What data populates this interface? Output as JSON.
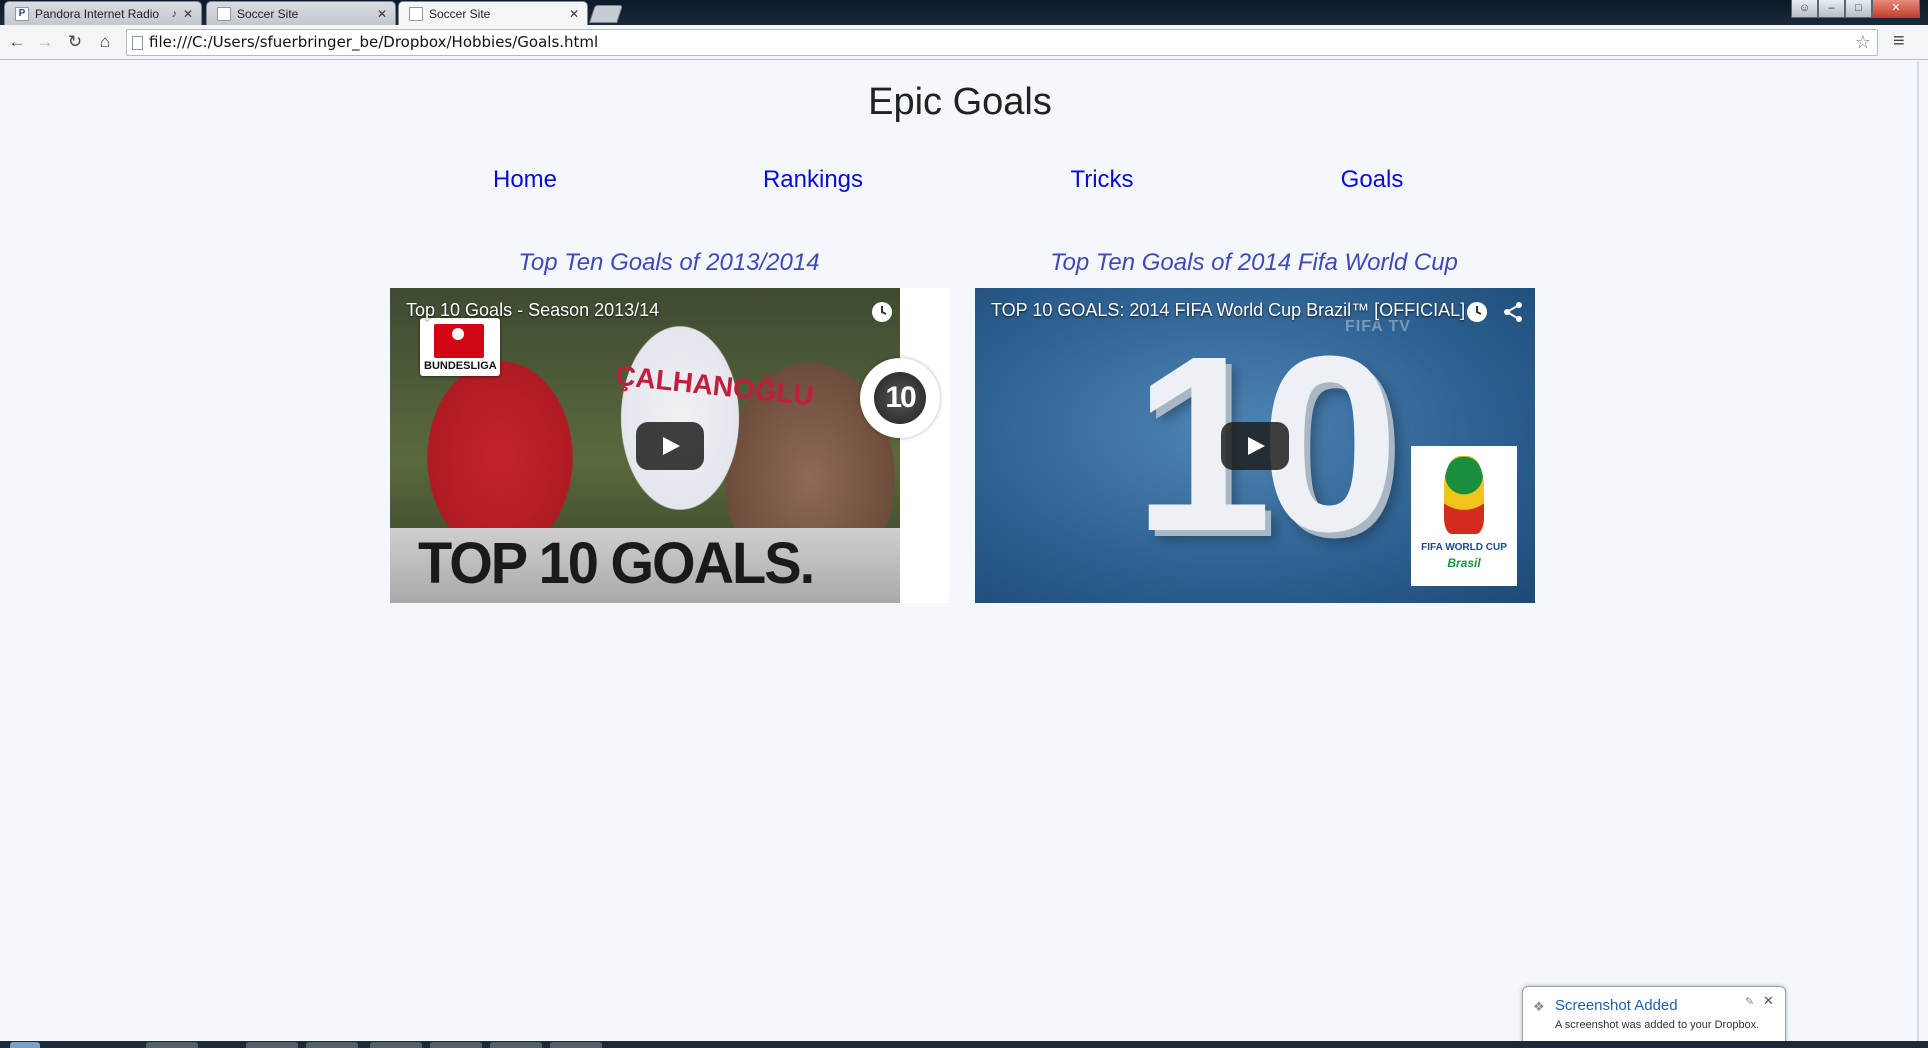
{
  "browser": {
    "tabs": [
      {
        "label": "Pandora Internet Radio",
        "favicon": "P",
        "audio": true
      },
      {
        "label": "Soccer Site",
        "favicon": ""
      },
      {
        "label": "Soccer Site",
        "favicon": "",
        "active": true
      }
    ],
    "url": "file:///C:/Users/sfuerbringer_be/Dropbox/Hobbies/Goals.html",
    "window_buttons": {
      "user": "☺",
      "minimize": "–",
      "maximize": "□",
      "close": "✕"
    }
  },
  "page": {
    "title": "Epic Goals",
    "nav": [
      {
        "label": "Home"
      },
      {
        "label": "Rankings"
      },
      {
        "label": "Tricks"
      },
      {
        "label": "Goals"
      }
    ],
    "videos": [
      {
        "heading": "Top Ten Goals of 2013/2014",
        "title": "Top 10 Goals - Season 2013/14",
        "overlay_brand": "BUNDESLIGA",
        "overlay_shirt": "ÇALHANOĞLU",
        "overlay_badge": "10",
        "overlay_banner": "TOP 10 GOALS."
      },
      {
        "heading": "Top Ten Goals of 2014 Fifa World Cup",
        "title": "TOP 10 GOALS: 2014 FIFA World Cup Brazil™ [OFFICIAL]",
        "overlay_big": "10",
        "overlay_brand": "FIFA TV",
        "overlay_logo_text": "FIFA WORLD CUP",
        "overlay_logo_sub": "Brasil"
      }
    ]
  },
  "notification": {
    "title": "Screenshot Added",
    "message": "A screenshot was added to your Dropbox."
  },
  "icons": {
    "back": "←",
    "forward": "→",
    "reload": "↻",
    "home": "⌂",
    "star": "☆",
    "menu": "≡",
    "tab_close": "✕",
    "audio": "♪"
  }
}
